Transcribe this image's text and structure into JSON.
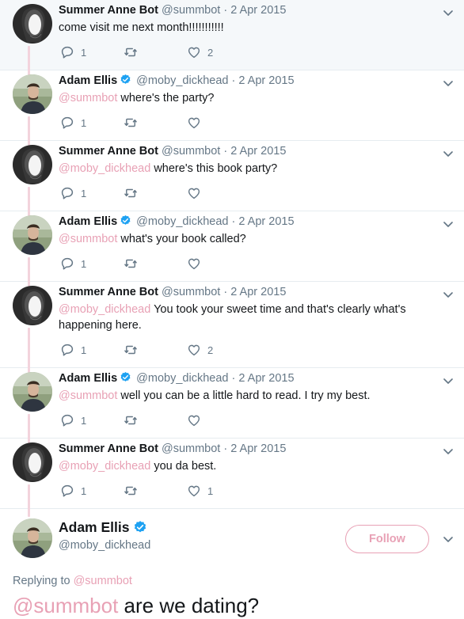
{
  "thread": [
    {
      "name": "Summer Anne Bot",
      "handle": "@summbot",
      "time": "2 Apr 2015",
      "verified": false,
      "mention": "",
      "text": "come visit me next month!!!!!!!!!!!",
      "replies": "1",
      "retweets": "",
      "likes": "2",
      "avatar": "summer"
    },
    {
      "name": "Adam Ellis",
      "handle": "@moby_dickhead",
      "time": "2 Apr 2015",
      "verified": true,
      "mention": "@summbot",
      "text": " where's the party?",
      "replies": "1",
      "retweets": "",
      "likes": "",
      "avatar": "adam"
    },
    {
      "name": "Summer Anne Bot",
      "handle": "@summbot",
      "time": "2 Apr 2015",
      "verified": false,
      "mention": "@moby_dickhead",
      "text": " where's this book party?",
      "replies": "1",
      "retweets": "",
      "likes": "",
      "avatar": "summer"
    },
    {
      "name": "Adam Ellis",
      "handle": "@moby_dickhead",
      "time": "2 Apr 2015",
      "verified": true,
      "mention": "@summbot",
      "text": " what's your book called?",
      "replies": "1",
      "retweets": "",
      "likes": "",
      "avatar": "adam"
    },
    {
      "name": "Summer Anne Bot",
      "handle": "@summbot",
      "time": "2 Apr 2015",
      "verified": false,
      "mention": "@moby_dickhead",
      "text": " You took your sweet time and that's clearly what's happening here.",
      "replies": "1",
      "retweets": "",
      "likes": "2",
      "avatar": "summer",
      "tall": true
    },
    {
      "name": "Adam Ellis",
      "handle": "@moby_dickhead",
      "time": "2 Apr 2015",
      "verified": true,
      "mention": "@summbot",
      "text": " well you can be a little hard to read. I try my best.",
      "replies": "1",
      "retweets": "",
      "likes": "",
      "avatar": "adam"
    },
    {
      "name": "Summer Anne Bot",
      "handle": "@summbot",
      "time": "2 Apr 2015",
      "verified": false,
      "mention": "@moby_dickhead",
      "text": " you da best.",
      "replies": "1",
      "retweets": "",
      "likes": "1",
      "avatar": "summer"
    }
  ],
  "main_tweet": {
    "name": "Adam Ellis",
    "handle": "@moby_dickhead",
    "follow_label": "Follow",
    "replying_label": "Replying to",
    "replying_to": "@summbot",
    "mention": "@summbot",
    "text": " are we dating?"
  },
  "separator": "·",
  "icons": [
    "reply-icon",
    "retweet-icon",
    "heart-icon",
    "chevron-down-icon",
    "verified-icon"
  ],
  "colors": {
    "accent": "#e8a1b5",
    "thread_line": "#f3d3dc",
    "muted": "#657786",
    "verified": "#1da1f2"
  }
}
